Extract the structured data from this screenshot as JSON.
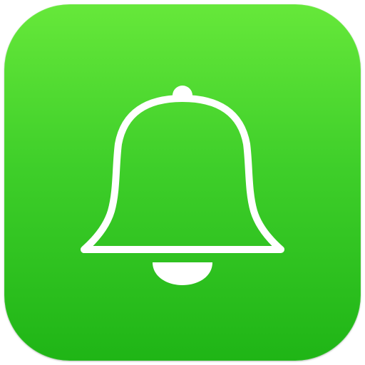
{
  "app_icon": {
    "icon": "bell-icon",
    "colors": {
      "gradient_top": "#66e83a",
      "gradient_mid": "#3fcf2a",
      "gradient_bottom": "#1fb516",
      "glyph": "#ffffff"
    }
  }
}
